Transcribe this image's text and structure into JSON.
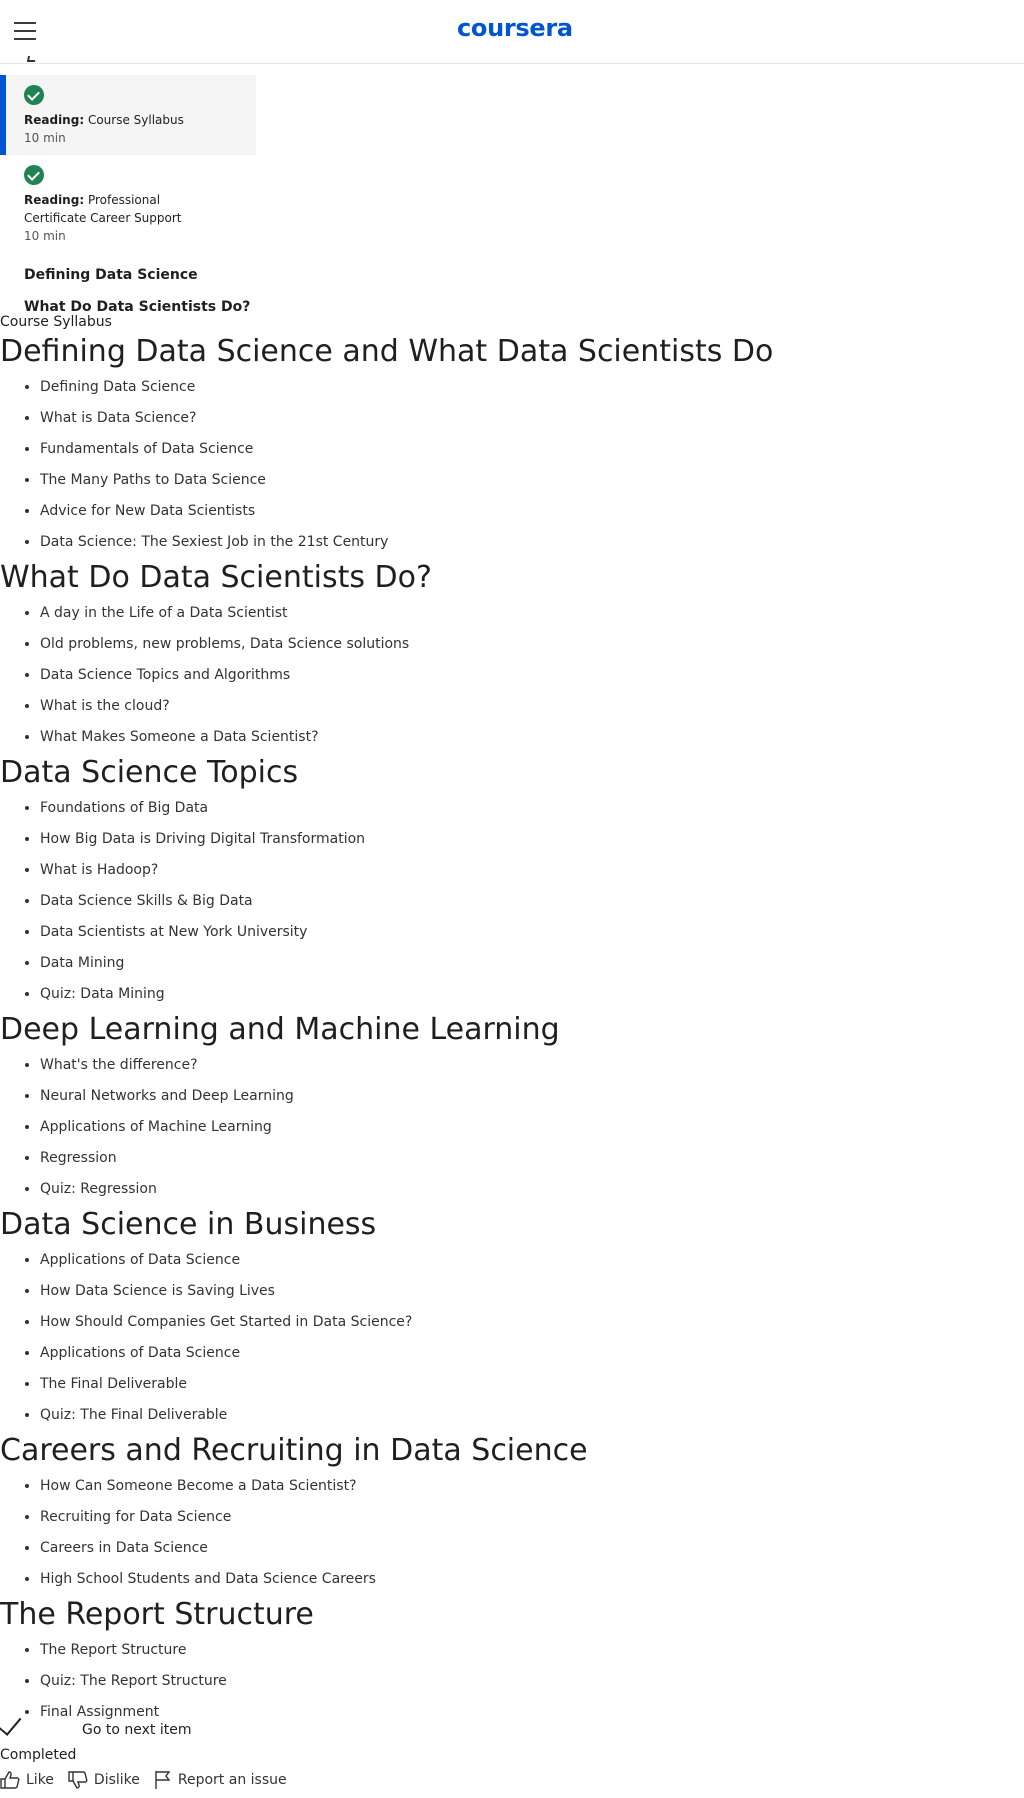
{
  "header": {
    "logo": "coursera",
    "menu_icon": "hamburger-menu-icon"
  },
  "sidebar": {
    "items": [
      {
        "type_label": "Reading:",
        "title": "Course Syllabus",
        "duration": "10 min",
        "completed": true,
        "active": true
      },
      {
        "type_label": "Reading:",
        "title": "Professional Certificate Career Support",
        "duration": "10 min",
        "completed": true,
        "active": false
      }
    ],
    "sections": [
      "Defining Data Science",
      "What Do Data Scientists Do?"
    ]
  },
  "main": {
    "breadcrumb": "Course Syllabus",
    "sections": [
      {
        "heading": "Defining Data Science and What Data Scientists Do",
        "items": [
          "Defining Data Science",
          "What is Data Science?",
          "Fundamentals of Data Science",
          "The Many Paths to Data Science",
          "Advice for New Data Scientists",
          "Data Science: The Sexiest Job in the 21st Century"
        ]
      },
      {
        "heading": "What Do Data Scientists Do?",
        "items": [
          "A day in the Life of a Data Scientist",
          "Old problems, new problems, Data Science solutions",
          "Data Science Topics and Algorithms",
          "What is the cloud?",
          "What Makes Someone a Data Scientist?"
        ]
      },
      {
        "heading": "Data Science Topics",
        "items": [
          "Foundations of Big Data",
          "How Big Data is Driving Digital Transformation",
          "What is Hadoop?",
          "Data Science Skills & Big Data",
          "Data Scientists at New York University",
          "Data Mining",
          "Quiz: Data Mining"
        ]
      },
      {
        "heading": "Deep Learning and Machine Learning",
        "items": [
          "What's the difference?",
          "Neural Networks and Deep Learning",
          "Applications of Machine Learning",
          "Regression",
          "Quiz: Regression"
        ]
      },
      {
        "heading": "Data Science in Business",
        "items": [
          "Applications of Data Science",
          "How Data Science is Saving Lives",
          "How Should Companies Get Started in Data Science?",
          "Applications of Data Science",
          "The Final Deliverable",
          "Quiz: The Final Deliverable"
        ]
      },
      {
        "heading": "Careers and Recruiting in Data Science",
        "items": [
          "How Can Someone Become a Data Scientist?",
          "Recruiting for Data Science",
          "Careers in Data Science",
          "High School Students and Data Science Careers"
        ]
      },
      {
        "heading": "The Report Structure",
        "items": [
          "The Report Structure",
          "Quiz: The Report Structure",
          "Final Assignment"
        ]
      }
    ]
  },
  "completion": {
    "next_label": "Go to next item",
    "status": "Completed"
  },
  "actions": {
    "like": "Like",
    "dislike": "Dislike",
    "report": "Report an issue"
  },
  "colors": {
    "brand": "#0056d2",
    "success": "#1f8354"
  }
}
